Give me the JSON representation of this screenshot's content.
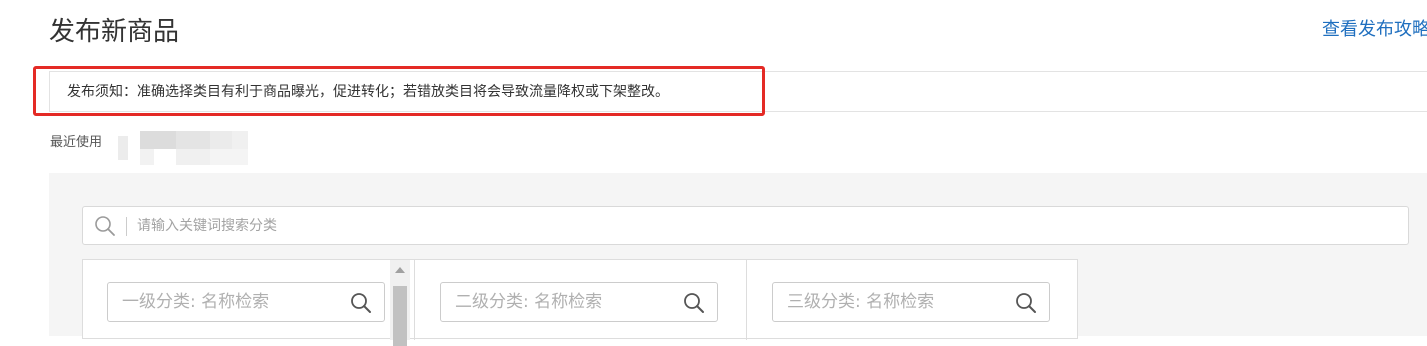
{
  "header": {
    "title": "发布新商品",
    "guide_link": "查看发布攻略"
  },
  "notice": {
    "text": "发布须知：准确选择类目有利于商品曝光，促进转化；若错放类目将会导致流量降权或下架整改。",
    "highlight_color": "#e42a25"
  },
  "recent": {
    "label": "最近使用"
  },
  "search": {
    "placeholder": "请输入关键词搜索分类",
    "icon": "search-icon"
  },
  "columns": [
    {
      "placeholder": "一级分类: 名称检索"
    },
    {
      "placeholder": "二级分类: 名称检索"
    },
    {
      "placeholder": "三级分类: 名称检索"
    }
  ],
  "colors": {
    "link": "#1f6fbf",
    "panel_background": "#f5f5f5",
    "border": "#dddddd"
  }
}
